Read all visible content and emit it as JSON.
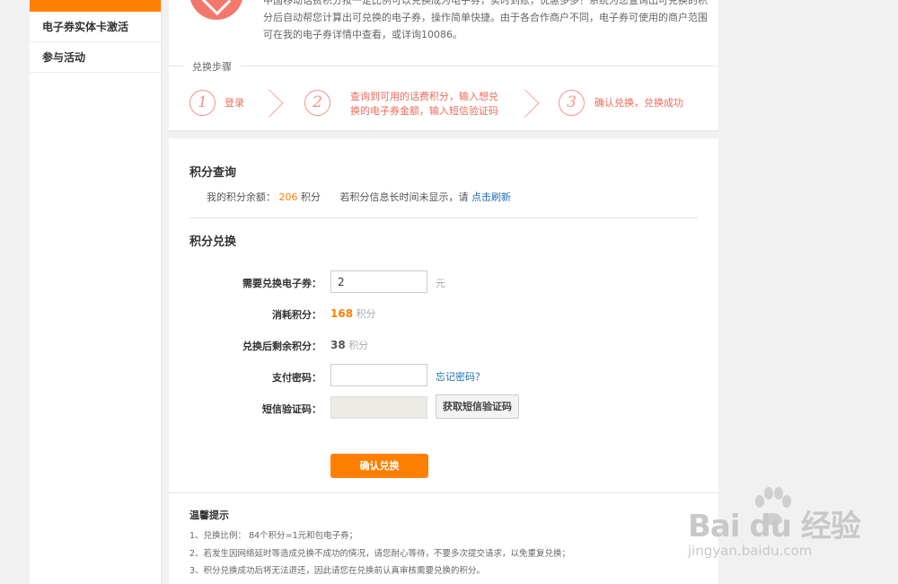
{
  "sidebar": {
    "items": [
      {
        "label": "电子券实体卡激活"
      },
      {
        "label": "参与活动"
      }
    ]
  },
  "intro": {
    "text": "中国移动话费积分按一定比例可以兑换成为电子券，实时到账，优惠多多！系统为您查询出可兑换的积分后自动帮您计算出可兑换的电子券，操作简单快捷。由于各合作商户不同，电子券可使用的商户范围可在我的电子券详情中查看，或详询10086。"
  },
  "steps": {
    "label": "兑换步骤",
    "items": [
      {
        "num": "1",
        "text": "登录"
      },
      {
        "num": "2",
        "text_line1": "查询到可用的话费积分，输入想兑",
        "text_line2": "换的电子券金额，输入短信验证码"
      },
      {
        "num": "3",
        "text": "确认兑换，兑换成功"
      }
    ]
  },
  "points_query": {
    "title": "积分查询",
    "balance_label": "我的积分余额：",
    "balance_value": "206",
    "balance_unit": "积分",
    "refresh_hint": "若积分信息长时间未显示，请",
    "refresh_link": "点击刷新"
  },
  "exchange": {
    "title": "积分兑换",
    "coupon_label": "需要兑换电子券：",
    "coupon_value": "2",
    "coupon_unit": "元",
    "cost_label": "消耗积分：",
    "cost_value": "168",
    "cost_unit": "积分",
    "remain_label": "兑换后剩余积分：",
    "remain_value": "38",
    "remain_unit": "积分",
    "password_label": "支付密码：",
    "forgot_link": "忘记密码？",
    "sms_label": "短信验证码：",
    "sms_button": "获取短信验证码",
    "confirm_button": "确认兑换"
  },
  "tips": {
    "title": "温馨提示",
    "items": [
      "1、兑换比例： 84个积分=1元和包电子券；",
      "2、若发生因网络延时等造成兑换不成功的情况，请您耐心等待，不要多次提交请求，以免重复兑换；",
      "3、积分兑换成功后将无法退还，因此请您在兑换前认真审核需要兑换的积分。"
    ]
  },
  "watermark": {
    "logo": "Bai du 经验",
    "sub": "jingyan.baidu.com"
  },
  "colors": {
    "accent": "#ff7f00",
    "step": "#ef6a5c",
    "link": "#1f6fb5"
  }
}
